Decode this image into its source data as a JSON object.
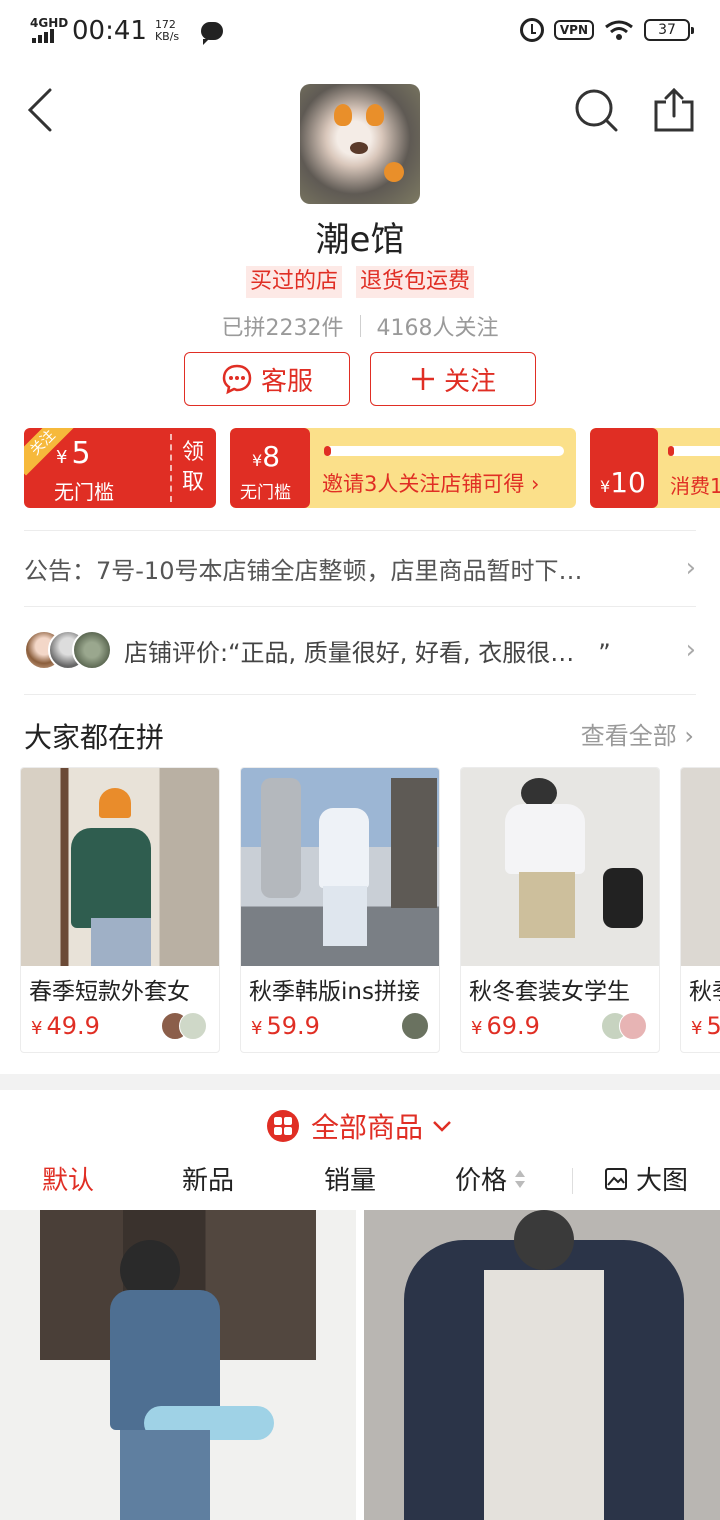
{
  "status_bar": {
    "network": "4GHD",
    "time": "00:41",
    "speed_value": "172",
    "speed_unit": "KB/s",
    "vpn": "VPN",
    "battery": "37"
  },
  "shop": {
    "name": "潮e馆",
    "tags": [
      "买过的店",
      "退货包运费"
    ],
    "sold": "已拼2232件",
    "followers": "4168人关注",
    "service_label": "客服",
    "follow_label": "关注"
  },
  "coupons": {
    "c1": {
      "corner": "关注",
      "currency": "¥",
      "amount": "5",
      "desc": "无门槛",
      "claim": "领取"
    },
    "c2": {
      "currency": "¥",
      "amount": "8",
      "desc": "无门槛",
      "text": "邀请3人关注店铺可得 ›",
      "progress": 0.03
    },
    "c3": {
      "currency": "¥",
      "amount": "10",
      "text": "消费1",
      "progress": 0.05
    }
  },
  "notice": {
    "text": "公告：7号-10号本店铺全店整顿，店里商品暂时下…"
  },
  "review": {
    "text": "店铺评价:“正品, 质量很好, 好看, 衣服很…　”"
  },
  "group_section": {
    "title": "大家都在拼",
    "see_all": "查看全部 ›",
    "items": [
      {
        "title": "春季短款外套女",
        "currency": "¥",
        "price": "49.9"
      },
      {
        "title": "秋季韩版ins拼接",
        "currency": "¥",
        "price": "59.9"
      },
      {
        "title": "秋冬套装女学生",
        "currency": "¥",
        "price": "69.9"
      },
      {
        "title": "秋季",
        "currency": "¥",
        "price": "5"
      }
    ]
  },
  "all_goods": {
    "label": "全部商品"
  },
  "sort_tabs": {
    "default": "默认",
    "new": "新品",
    "sales": "销量",
    "price": "价格",
    "big_image": "大图"
  },
  "colors": {
    "accent": "#e02e24",
    "coupon_yellow": "#fbe08a"
  }
}
